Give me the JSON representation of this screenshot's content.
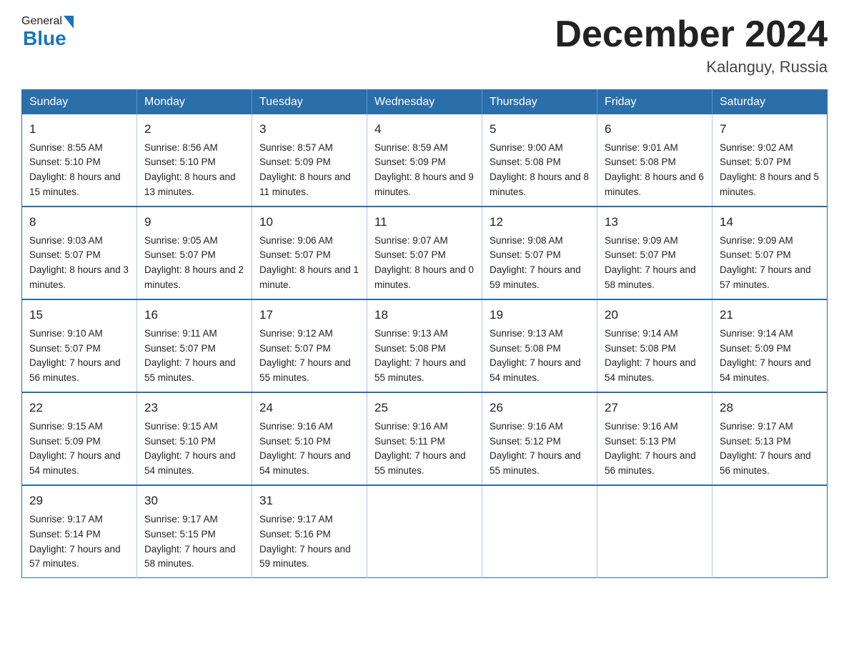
{
  "header": {
    "logo_general": "General",
    "logo_blue": "Blue",
    "month_title": "December 2024",
    "location": "Kalanguy, Russia"
  },
  "days_of_week": [
    "Sunday",
    "Monday",
    "Tuesday",
    "Wednesday",
    "Thursday",
    "Friday",
    "Saturday"
  ],
  "weeks": [
    [
      {
        "day": "1",
        "sunrise": "Sunrise: 8:55 AM",
        "sunset": "Sunset: 5:10 PM",
        "daylight": "Daylight: 8 hours and 15 minutes."
      },
      {
        "day": "2",
        "sunrise": "Sunrise: 8:56 AM",
        "sunset": "Sunset: 5:10 PM",
        "daylight": "Daylight: 8 hours and 13 minutes."
      },
      {
        "day": "3",
        "sunrise": "Sunrise: 8:57 AM",
        "sunset": "Sunset: 5:09 PM",
        "daylight": "Daylight: 8 hours and 11 minutes."
      },
      {
        "day": "4",
        "sunrise": "Sunrise: 8:59 AM",
        "sunset": "Sunset: 5:09 PM",
        "daylight": "Daylight: 8 hours and 9 minutes."
      },
      {
        "day": "5",
        "sunrise": "Sunrise: 9:00 AM",
        "sunset": "Sunset: 5:08 PM",
        "daylight": "Daylight: 8 hours and 8 minutes."
      },
      {
        "day": "6",
        "sunrise": "Sunrise: 9:01 AM",
        "sunset": "Sunset: 5:08 PM",
        "daylight": "Daylight: 8 hours and 6 minutes."
      },
      {
        "day": "7",
        "sunrise": "Sunrise: 9:02 AM",
        "sunset": "Sunset: 5:07 PM",
        "daylight": "Daylight: 8 hours and 5 minutes."
      }
    ],
    [
      {
        "day": "8",
        "sunrise": "Sunrise: 9:03 AM",
        "sunset": "Sunset: 5:07 PM",
        "daylight": "Daylight: 8 hours and 3 minutes."
      },
      {
        "day": "9",
        "sunrise": "Sunrise: 9:05 AM",
        "sunset": "Sunset: 5:07 PM",
        "daylight": "Daylight: 8 hours and 2 minutes."
      },
      {
        "day": "10",
        "sunrise": "Sunrise: 9:06 AM",
        "sunset": "Sunset: 5:07 PM",
        "daylight": "Daylight: 8 hours and 1 minute."
      },
      {
        "day": "11",
        "sunrise": "Sunrise: 9:07 AM",
        "sunset": "Sunset: 5:07 PM",
        "daylight": "Daylight: 8 hours and 0 minutes."
      },
      {
        "day": "12",
        "sunrise": "Sunrise: 9:08 AM",
        "sunset": "Sunset: 5:07 PM",
        "daylight": "Daylight: 7 hours and 59 minutes."
      },
      {
        "day": "13",
        "sunrise": "Sunrise: 9:09 AM",
        "sunset": "Sunset: 5:07 PM",
        "daylight": "Daylight: 7 hours and 58 minutes."
      },
      {
        "day": "14",
        "sunrise": "Sunrise: 9:09 AM",
        "sunset": "Sunset: 5:07 PM",
        "daylight": "Daylight: 7 hours and 57 minutes."
      }
    ],
    [
      {
        "day": "15",
        "sunrise": "Sunrise: 9:10 AM",
        "sunset": "Sunset: 5:07 PM",
        "daylight": "Daylight: 7 hours and 56 minutes."
      },
      {
        "day": "16",
        "sunrise": "Sunrise: 9:11 AM",
        "sunset": "Sunset: 5:07 PM",
        "daylight": "Daylight: 7 hours and 55 minutes."
      },
      {
        "day": "17",
        "sunrise": "Sunrise: 9:12 AM",
        "sunset": "Sunset: 5:07 PM",
        "daylight": "Daylight: 7 hours and 55 minutes."
      },
      {
        "day": "18",
        "sunrise": "Sunrise: 9:13 AM",
        "sunset": "Sunset: 5:08 PM",
        "daylight": "Daylight: 7 hours and 55 minutes."
      },
      {
        "day": "19",
        "sunrise": "Sunrise: 9:13 AM",
        "sunset": "Sunset: 5:08 PM",
        "daylight": "Daylight: 7 hours and 54 minutes."
      },
      {
        "day": "20",
        "sunrise": "Sunrise: 9:14 AM",
        "sunset": "Sunset: 5:08 PM",
        "daylight": "Daylight: 7 hours and 54 minutes."
      },
      {
        "day": "21",
        "sunrise": "Sunrise: 9:14 AM",
        "sunset": "Sunset: 5:09 PM",
        "daylight": "Daylight: 7 hours and 54 minutes."
      }
    ],
    [
      {
        "day": "22",
        "sunrise": "Sunrise: 9:15 AM",
        "sunset": "Sunset: 5:09 PM",
        "daylight": "Daylight: 7 hours and 54 minutes."
      },
      {
        "day": "23",
        "sunrise": "Sunrise: 9:15 AM",
        "sunset": "Sunset: 5:10 PM",
        "daylight": "Daylight: 7 hours and 54 minutes."
      },
      {
        "day": "24",
        "sunrise": "Sunrise: 9:16 AM",
        "sunset": "Sunset: 5:10 PM",
        "daylight": "Daylight: 7 hours and 54 minutes."
      },
      {
        "day": "25",
        "sunrise": "Sunrise: 9:16 AM",
        "sunset": "Sunset: 5:11 PM",
        "daylight": "Daylight: 7 hours and 55 minutes."
      },
      {
        "day": "26",
        "sunrise": "Sunrise: 9:16 AM",
        "sunset": "Sunset: 5:12 PM",
        "daylight": "Daylight: 7 hours and 55 minutes."
      },
      {
        "day": "27",
        "sunrise": "Sunrise: 9:16 AM",
        "sunset": "Sunset: 5:13 PM",
        "daylight": "Daylight: 7 hours and 56 minutes."
      },
      {
        "day": "28",
        "sunrise": "Sunrise: 9:17 AM",
        "sunset": "Sunset: 5:13 PM",
        "daylight": "Daylight: 7 hours and 56 minutes."
      }
    ],
    [
      {
        "day": "29",
        "sunrise": "Sunrise: 9:17 AM",
        "sunset": "Sunset: 5:14 PM",
        "daylight": "Daylight: 7 hours and 57 minutes."
      },
      {
        "day": "30",
        "sunrise": "Sunrise: 9:17 AM",
        "sunset": "Sunset: 5:15 PM",
        "daylight": "Daylight: 7 hours and 58 minutes."
      },
      {
        "day": "31",
        "sunrise": "Sunrise: 9:17 AM",
        "sunset": "Sunset: 5:16 PM",
        "daylight": "Daylight: 7 hours and 59 minutes."
      },
      null,
      null,
      null,
      null
    ]
  ]
}
